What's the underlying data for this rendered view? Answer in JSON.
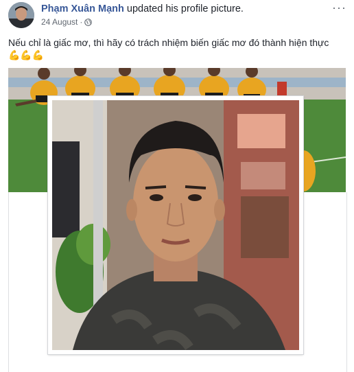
{
  "post": {
    "author": "Phạm Xuân Mạnh",
    "action": " updated his profile picture.",
    "date": "24 August",
    "date_separator": "·",
    "more_label": "···",
    "caption": "Nếu chỉ là giấc mơ, thì hãy có trách nhiệm biến giấc mơ đó thành hiện thực",
    "emojis": "💪💪💪",
    "audience_icon": "globe-icon",
    "colors": {
      "author_link": "#385898",
      "meta_text": "#606770",
      "pitch_green": "#4e8a3a",
      "jersey_yellow": "#e8a521"
    }
  }
}
